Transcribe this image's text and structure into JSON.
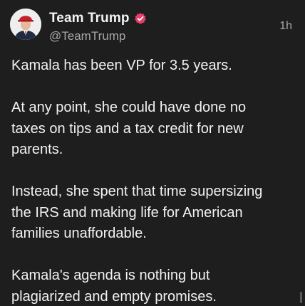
{
  "post": {
    "author": {
      "display_name": "Team Trump",
      "handle": "@TeamTrump",
      "verified": true,
      "verified_icon": "verified-badge-icon",
      "avatar_icon": "avatar-icon"
    },
    "timestamp": "1h",
    "paragraphs": [
      "Kamala has been VP for 3.5 years.",
      "At any point, she could have done no\ntaxes on tips and a tax credit for new\nparents.",
      "Instead, she spent that time supersizing\nthe IRS and making life for American\nfamilies unaffordable.",
      "Kamala's agenda is nothing but\nplagiarized and empty promises."
    ]
  },
  "colors": {
    "background": "#1e1e1f",
    "text": "#f2f2f2",
    "muted": "#a8a8ac",
    "badge": "#e5416a"
  }
}
